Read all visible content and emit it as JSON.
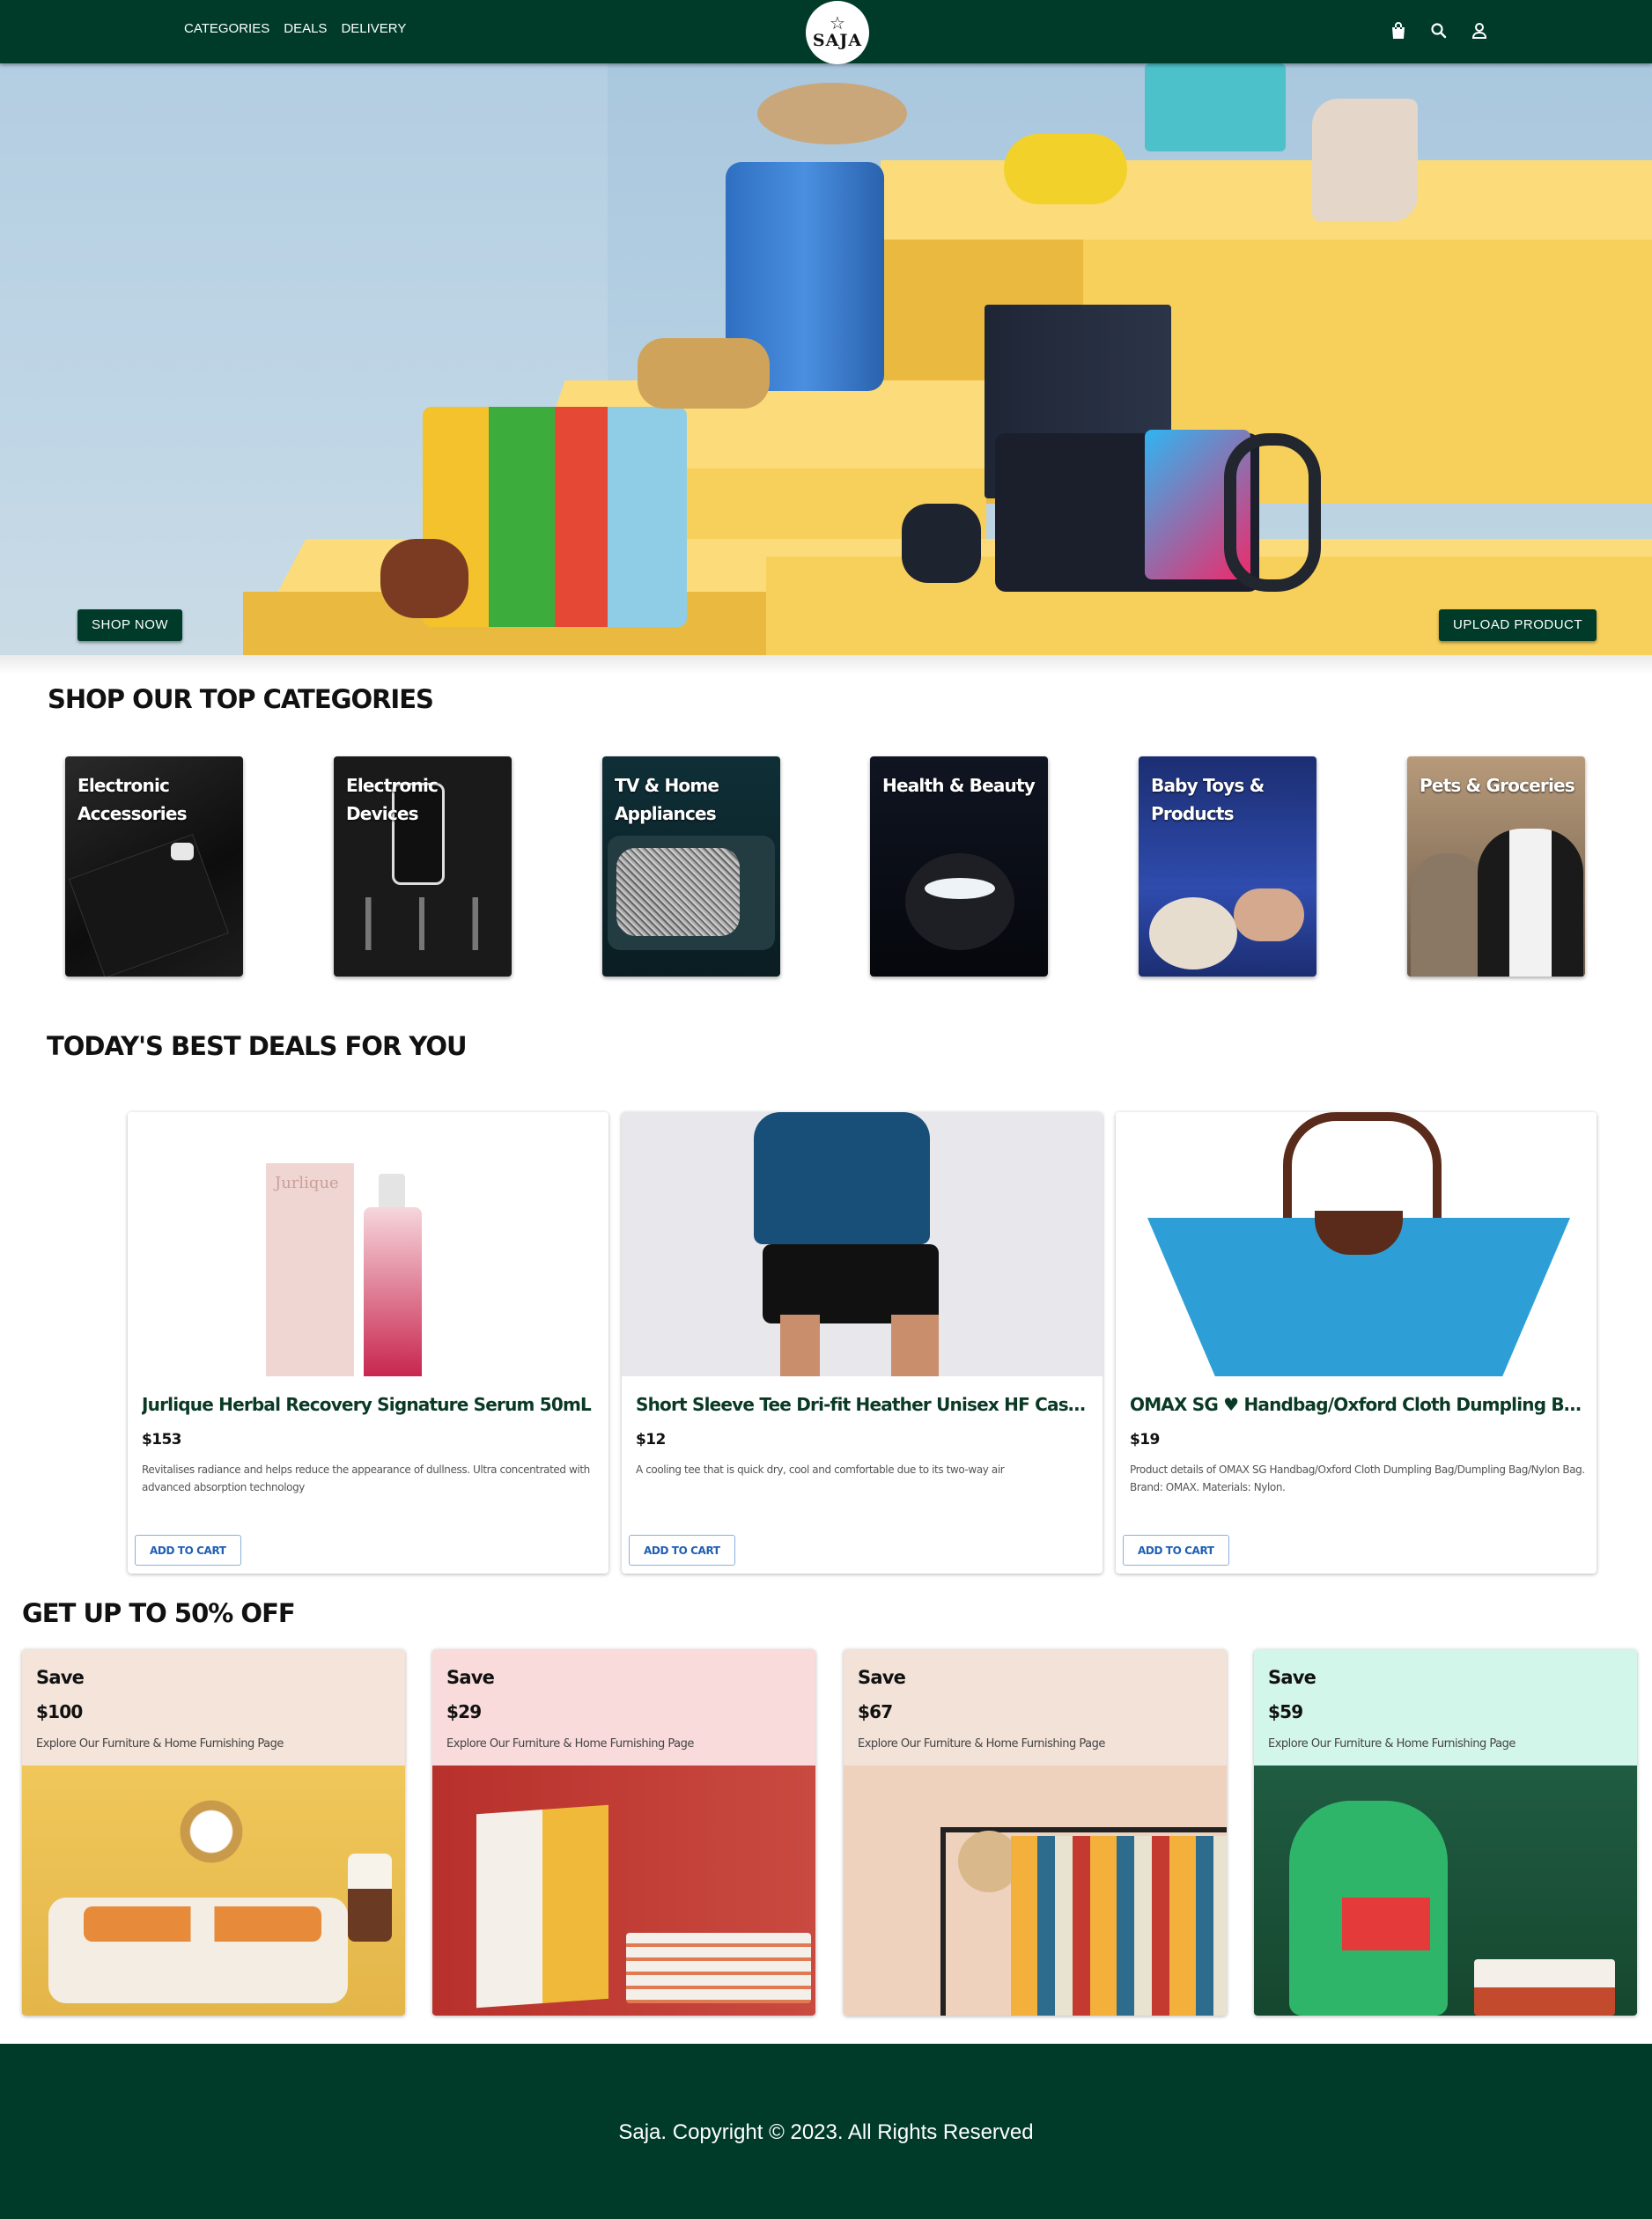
{
  "nav": {
    "links": [
      "CATEGORIES",
      "DEALS",
      "DELIVERY"
    ],
    "logo_text": "SAJA",
    "icons": [
      "shopping-bag-icon",
      "search-icon",
      "user-icon"
    ]
  },
  "hero": {
    "shop_now": "SHOP NOW",
    "upload_product": "UPLOAD PRODUCT"
  },
  "categories": {
    "title": "SHOP OUR TOP CATEGORIES",
    "items": [
      {
        "label": "Electronic Accessories"
      },
      {
        "label": "Electronic Devices"
      },
      {
        "label": "TV & Home Appliances"
      },
      {
        "label": "Health & Beauty"
      },
      {
        "label": "Baby Toys & Products"
      },
      {
        "label": "Pets & Groceries"
      }
    ]
  },
  "deals": {
    "title": "TODAY'S BEST DEALS FOR YOU",
    "items": [
      {
        "title": "Jurlique Herbal Recovery Signature Serum 50mL",
        "price": "$153",
        "desc": "Revitalises radiance and helps reduce the appearance of dullness. Ultra concentrated with advanced absorption technology",
        "button": "ADD TO CART",
        "brand_text": "Jurlique"
      },
      {
        "title": "Short Sleeve Tee Dri-fit Heather Unisex HF Casual | Home...",
        "price": "$12",
        "desc": "A cooling tee that is quick dry, cool and comfortable due to its two-way air",
        "button": "ADD TO CART"
      },
      {
        "title": "OMAX SG ♥ Handbag/Oxford Cloth Dumpling Bag/Dumplin...",
        "price": "$19",
        "desc": "Product details of OMAX SG Handbag/Oxford Cloth Dumpling Bag/Dumpling Bag/Nylon Bag. Brand: OMAX. Materials: Nylon.",
        "button": "ADD TO CART"
      }
    ]
  },
  "save": {
    "title": "GET UP TO 50% OFF",
    "items": [
      {
        "word": "Save",
        "amount": "$100",
        "desc": "Explore Our Furniture & Home Furnishing Page",
        "color": "#f4e4da"
      },
      {
        "word": "Save",
        "amount": "$29",
        "desc": "Explore Our Furniture & Home Furnishing Page",
        "color": "#f9dbdb"
      },
      {
        "word": "Save",
        "amount": "$67",
        "desc": "Explore Our Furniture & Home Furnishing Page",
        "color": "#f2e2d8"
      },
      {
        "word": "Save",
        "amount": "$59",
        "desc": "Explore Our Furniture & Home Furnishing Page",
        "color": "#d3f6ea"
      }
    ]
  },
  "footer": {
    "text": "Saja. Copyright © 2023. All Rights Reserved"
  },
  "colors": {
    "brand_green": "#003b2a",
    "accent_yellow": "#f7cf5b",
    "link_blue": "#1f5fb4"
  }
}
